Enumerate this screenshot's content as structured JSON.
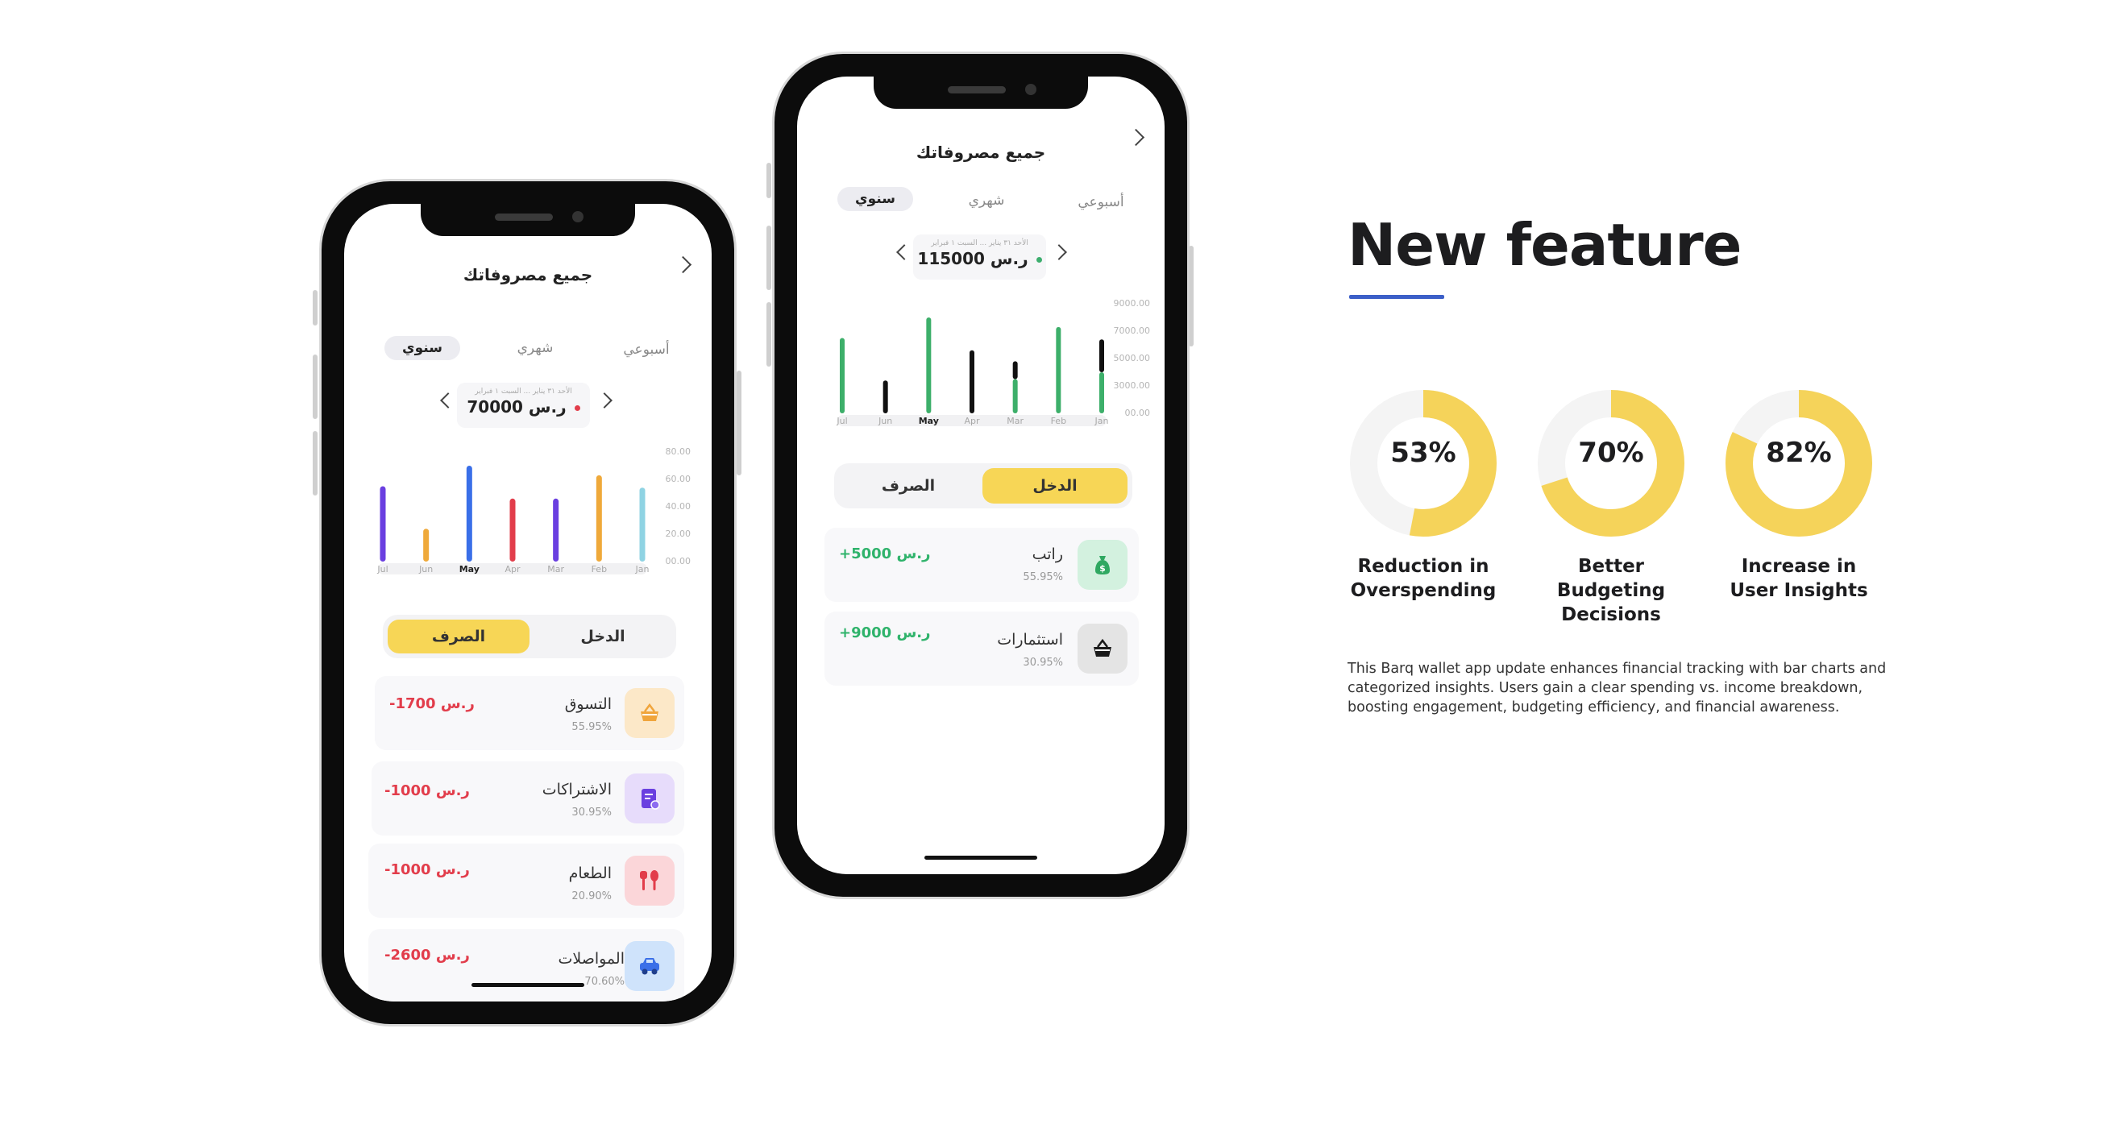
{
  "left_phone": {
    "title": "جميع مصروفاتك",
    "tabs": [
      "سنوي",
      "شهري",
      "أسبوعي"
    ],
    "date_range": "الأحد ٣١ يناير ... السبت ١ فبراير",
    "total": "70000 ر.س",
    "total_dot_color": "#e23d4b",
    "y_ticks": [
      "80.00",
      "60.00",
      "40.00",
      "20.00",
      "00.00"
    ],
    "toggle": {
      "active": "الصرف",
      "other": "الدخل"
    },
    "cards": [
      {
        "name": "التسوق",
        "pct": "55.95%",
        "amount": "-1700 ر.س",
        "icon": "shopping-basket-icon"
      },
      {
        "name": "الاشتراكات",
        "pct": "30.95%",
        "amount": "-1000 ر.س",
        "icon": "subscription-icon"
      },
      {
        "name": "الطعام",
        "pct": "20.90%",
        "amount": "-1000 ر.س",
        "icon": "food-icon"
      },
      {
        "name": "المواصلات",
        "pct": "70.60%",
        "amount": "-2600 ر.س",
        "icon": "car-icon"
      }
    ],
    "amount_color": "#e23d4b"
  },
  "right_phone": {
    "title": "جميع مصروفاتك",
    "tabs": [
      "سنوي",
      "شهري",
      "أسبوعي"
    ],
    "date_range": "الأحد ٣١ يناير ... السبت ١ فبراير",
    "total": "115000 ر.س",
    "total_dot_color": "#3dae6e",
    "y_ticks": [
      "9000.00",
      "7000.00",
      "5000.00",
      "3000.00",
      "00.00"
    ],
    "toggle": {
      "active": "الدخل",
      "other": "الصرف"
    },
    "cards": [
      {
        "name": "راتب",
        "pct": "55.95%",
        "amount": "+5000 ر.س",
        "icon": "money-bag-icon"
      },
      {
        "name": "استثمارات",
        "pct": "30.95%",
        "amount": "+9000 ر.س",
        "icon": "basket-icon"
      }
    ],
    "amount_color": "#2fb36b"
  },
  "chart_data": [
    {
      "type": "bar",
      "categories": [
        "Jul",
        "Jun",
        "May",
        "Apr",
        "Mar",
        "Feb",
        "Jan"
      ],
      "values": [
        55,
        24,
        70,
        46,
        46,
        63,
        54
      ],
      "colors": [
        "#6a3fe0",
        "#efa93a",
        "#3a6fe8",
        "#e23d4b",
        "#6a3fe0",
        "#efa93a",
        "#8fd3e3"
      ],
      "highlight": "May",
      "ylim": [
        0,
        80
      ],
      "y_ticks": [
        "80.00",
        "60.00",
        "40.00",
        "20.00",
        "00.00"
      ]
    },
    {
      "type": "bar",
      "categories": [
        "Jul",
        "Jun",
        "May",
        "Apr",
        "Mar",
        "Feb",
        "Jan"
      ],
      "series": [
        {
          "values": [
            5500,
            0,
            7000,
            0,
            2500,
            6300,
            3000
          ]
        },
        {
          "values": [
            0,
            2400,
            0,
            4600,
            1300,
            0,
            2400
          ]
        }
      ],
      "colors": [
        "#3daf6a",
        "#111111"
      ],
      "highlight": "May",
      "ylim": [
        0,
        8000
      ],
      "y_ticks": [
        "9000.00",
        "7000.00",
        "5000.00",
        "3000.00",
        "00.00"
      ]
    }
  ],
  "feature": {
    "title": "New feature",
    "accent": "#3c5fc8",
    "ring_color": "#f5d35a",
    "track_color": "#f4f4f4",
    "stats": [
      {
        "value": 53,
        "pct": "53%",
        "label": "Reduction in Overspending"
      },
      {
        "value": 70,
        "pct": "70%",
        "label": "Better Budgeting Decisions"
      },
      {
        "value": 82,
        "pct": "82%",
        "label": "Increase in User Insights"
      }
    ],
    "description": "This Barq wallet app update enhances financial tracking with bar charts and categorized insights. Users gain a clear spending vs. income breakdown, boosting engagement, budgeting efficiency, and financial awareness."
  }
}
